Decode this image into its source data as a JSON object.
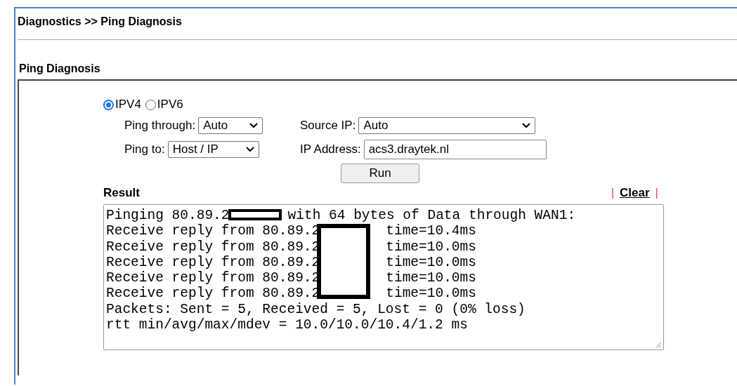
{
  "page_title": "Diagnostics >> Ping Diagnosis",
  "section_title": "Ping Diagnosis",
  "ip_versions": [
    {
      "label": "IPV4",
      "selected": true
    },
    {
      "label": "IPV6",
      "selected": false
    }
  ],
  "ping_through": {
    "label": "Ping through:",
    "value": "Auto"
  },
  "source_ip": {
    "label": "Source IP:",
    "value": "Auto"
  },
  "ping_to": {
    "label": "Ping to:",
    "value": "Host / IP"
  },
  "ip_address": {
    "label": "IP Address:",
    "value": "acs3.draytek.nl"
  },
  "run_button": "Run",
  "result": {
    "label": "Result",
    "separator_left": "|",
    "clear_link": "Clear",
    "separator_right": "|",
    "lines": [
      {
        "text": "Pinging 80.89.2",
        "tail": "with 64 bytes of Data through WAN1:"
      },
      {
        "text": "Receive reply from 80.89.2",
        "tail": "time=10.4ms"
      },
      {
        "text": "Receive reply from 80.89.2",
        "tail": "time=10.0ms"
      },
      {
        "text": "Receive reply from 80.89.2",
        "tail": "time=10.0ms"
      },
      {
        "text": "Receive reply from 80.89.2",
        "tail": "time=10.0ms"
      },
      {
        "text": "Receive reply from 80.89.2",
        "tail": "time=10.0ms"
      },
      {
        "text": "Packets: Sent = 5, Received = 5, Lost = 0 (0% loss)"
      },
      {
        "text": "rtt min/avg/max/mdev = 10.0/10.0/10.4/1.2 ms"
      }
    ]
  }
}
